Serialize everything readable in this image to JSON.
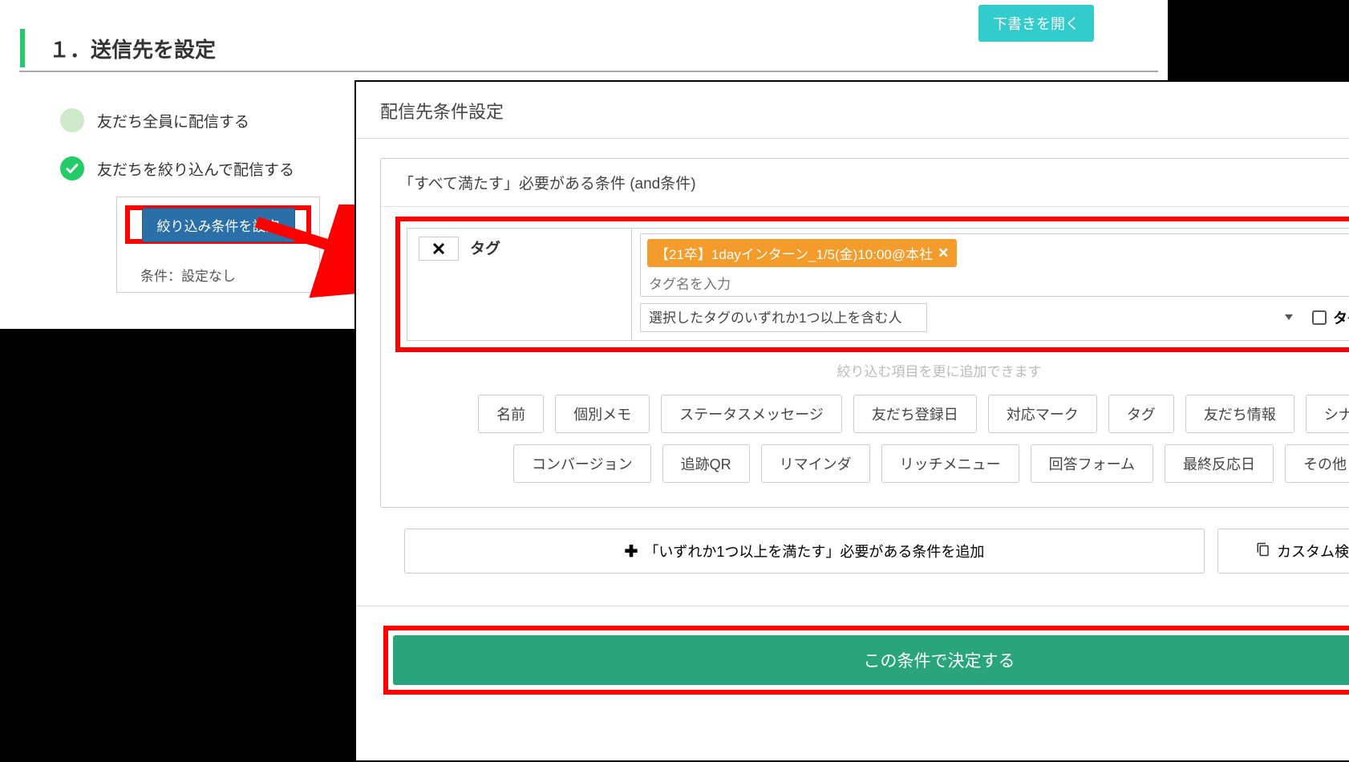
{
  "header": {
    "open_draft": "下書きを開く",
    "section_title": "１．送信先を設定"
  },
  "left": {
    "option_all": "友だち全員に配信する",
    "option_filter": "友だちを絞り込んで配信する",
    "set_filter": "絞り込み条件を設定",
    "condition_label": "条件：設定なし"
  },
  "modal": {
    "title": "配信先条件設定",
    "and_header": "「すべて満たす」必要がある条件 (and条件)",
    "tag_label": "タグ",
    "selected_tag": "【21卒】1dayインターン_1/5(金)10:00@本社",
    "tag_placeholder": "タグ名を入力",
    "tag_rule": "選択したタグのいずれか1つ以上を含む人",
    "tag_folder_label": "タグフォルダで指定",
    "add_hint": "絞り込む項目を更に追加できます",
    "filters": [
      "名前",
      "個別メモ",
      "ステータスメッセージ",
      "友だち登録日",
      "対応マーク",
      "タグ",
      "友だち情報",
      "シナリオ",
      "コンバージョン",
      "追跡QR",
      "リマインダ",
      "リッチメニュー",
      "回答フォーム",
      "最終反応日",
      "その他"
    ],
    "add_or": "「いずれか1つ以上を満たす」必要がある条件を追加",
    "copy_custom": "カスタム検索からコピー",
    "confirm": "この条件で決定する"
  }
}
